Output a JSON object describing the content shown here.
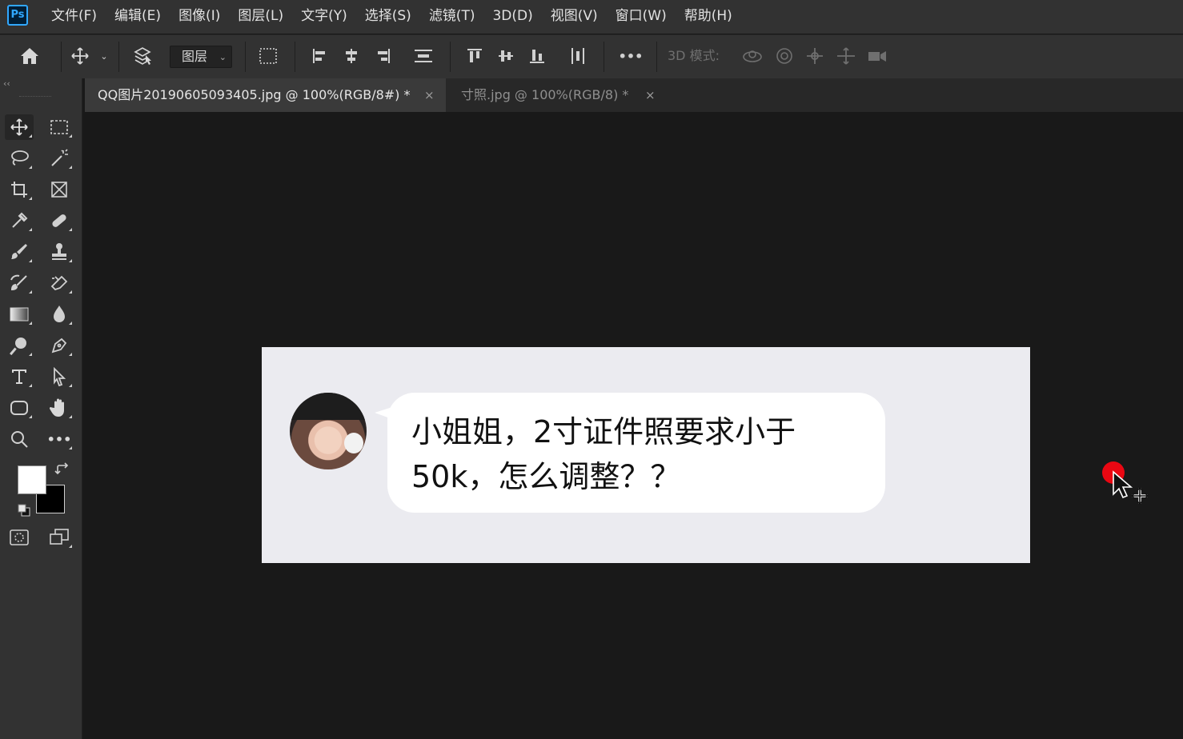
{
  "app": {
    "logo_text": "Ps"
  },
  "menu": [
    "文件(F)",
    "编辑(E)",
    "图像(I)",
    "图层(L)",
    "文字(Y)",
    "选择(S)",
    "滤镜(T)",
    "3D(D)",
    "视图(V)",
    "窗口(W)",
    "帮助(H)"
  ],
  "options_bar": {
    "auto_select_target": "图层",
    "more_label": "•••",
    "mode_3d_label": "3D 模式:"
  },
  "tabs": [
    {
      "title": "QQ图片20190605093405.jpg @ 100%(RGB/8#) *",
      "active": true
    },
    {
      "title": "寸照.jpg @ 100%(RGB/8) *",
      "active": false
    }
  ],
  "tab_close_glyph": "×",
  "toolbar": {
    "collapse_glyph": "‹‹",
    "foreground_color": "#ffffff",
    "background_color": "#000000",
    "tools": [
      "move-tool",
      "marquee-tool",
      "lasso-tool",
      "magic-wand-tool",
      "crop-tool",
      "frame-tool",
      "eyedropper-tool",
      "healing-brush-tool",
      "brush-tool",
      "clone-stamp-tool",
      "history-brush-tool",
      "eraser-tool",
      "gradient-tool",
      "blur-tool",
      "dodge-tool",
      "pen-tool",
      "type-tool",
      "path-selection-tool",
      "rectangle-tool",
      "hand-tool",
      "zoom-tool",
      "edit-toolbar",
      "quick-mask",
      "screen-mode"
    ]
  },
  "canvas": {
    "background": "#ebebf0",
    "message_line1": "小姐姐，2寸证件照要求小于",
    "message_line2": "50k，怎么调整？？"
  },
  "accent": {
    "ps_blue": "#31a8ff",
    "record_red": "#ea0712"
  }
}
